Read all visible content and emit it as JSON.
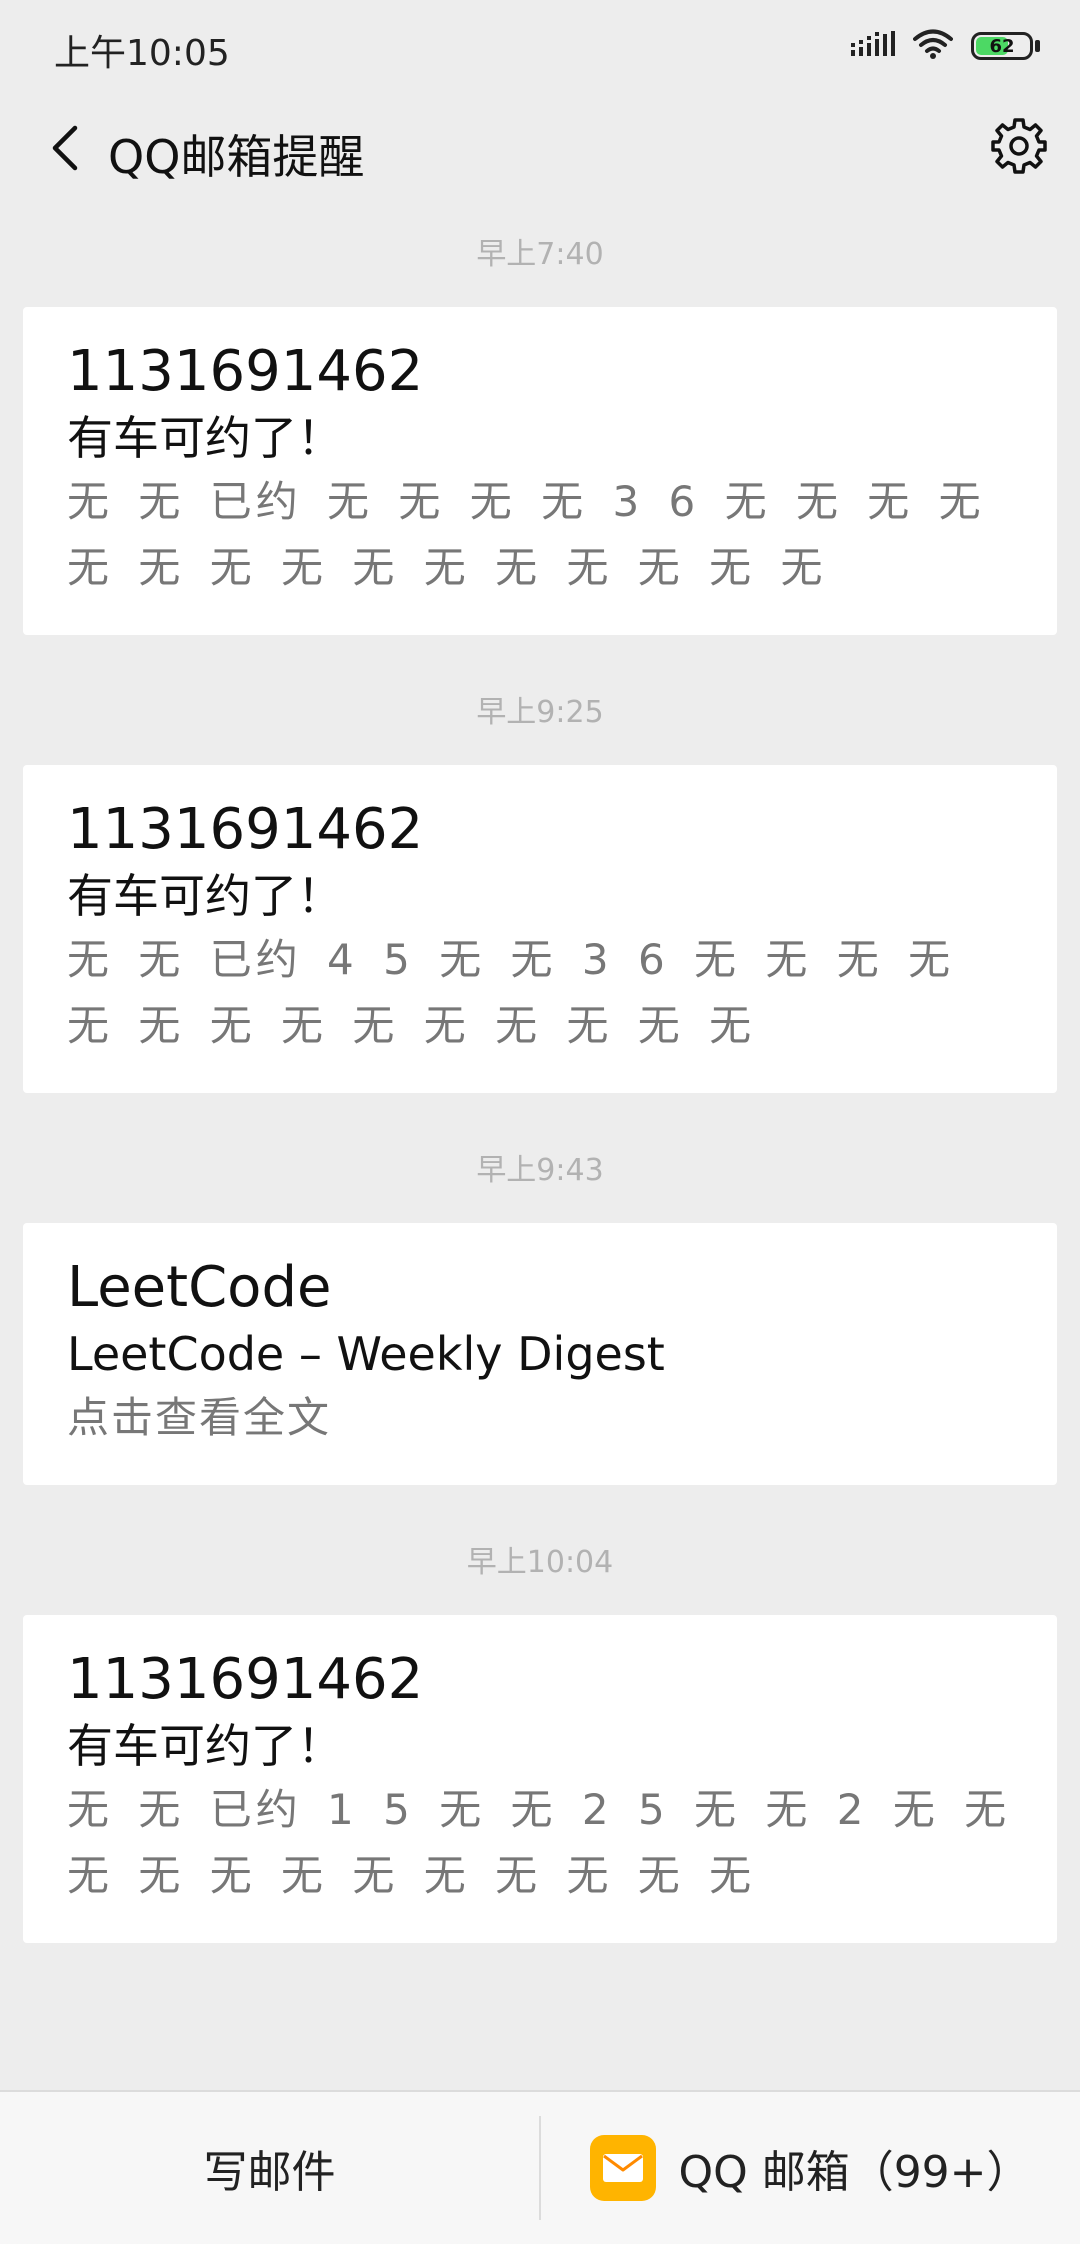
{
  "status_bar": {
    "time": "上午10:05",
    "battery_level": "62",
    "battery_fraction": 0.62,
    "icons": [
      "signal-icon",
      "wifi-icon",
      "battery-icon"
    ]
  },
  "nav": {
    "title": "QQ邮箱提醒",
    "back_icon": "chevron-left-icon",
    "settings_icon": "gear-icon"
  },
  "messages": [
    {
      "time": "早上7:40",
      "sender": "1131691462",
      "subject": "有车可约了！",
      "body": "无 无 已约 无 无 无 无 3 6 无 无 无 无 无 无 无 无 无 无 无 无 无 无 无"
    },
    {
      "time": "早上9:25",
      "sender": "1131691462",
      "subject": "有车可约了！",
      "body": "无 无 已约 4 5 无 无 3 6 无 无 无 无 无 无 无 无 无 无 无 无 无 无"
    },
    {
      "time": "早上9:43",
      "sender": "LeetCode",
      "subject": "LeetCode – Weekly Digest",
      "body": "点击查看全文"
    },
    {
      "time": "早上10:04",
      "sender": "1131691462",
      "subject": "有车可约了！",
      "body": "无 无 已约 1 5 无 无 2 5 无 无 2 无 无 无 无 无 无 无 无 无 无 无 无"
    }
  ],
  "bottom_bar": {
    "compose_label": "写邮件",
    "app_label": "QQ 邮箱（99+）",
    "app_icon": "mail-envelope-icon",
    "colors": {
      "app_icon_bg": "#ffb400",
      "battery_fill": "#4cd964"
    }
  }
}
